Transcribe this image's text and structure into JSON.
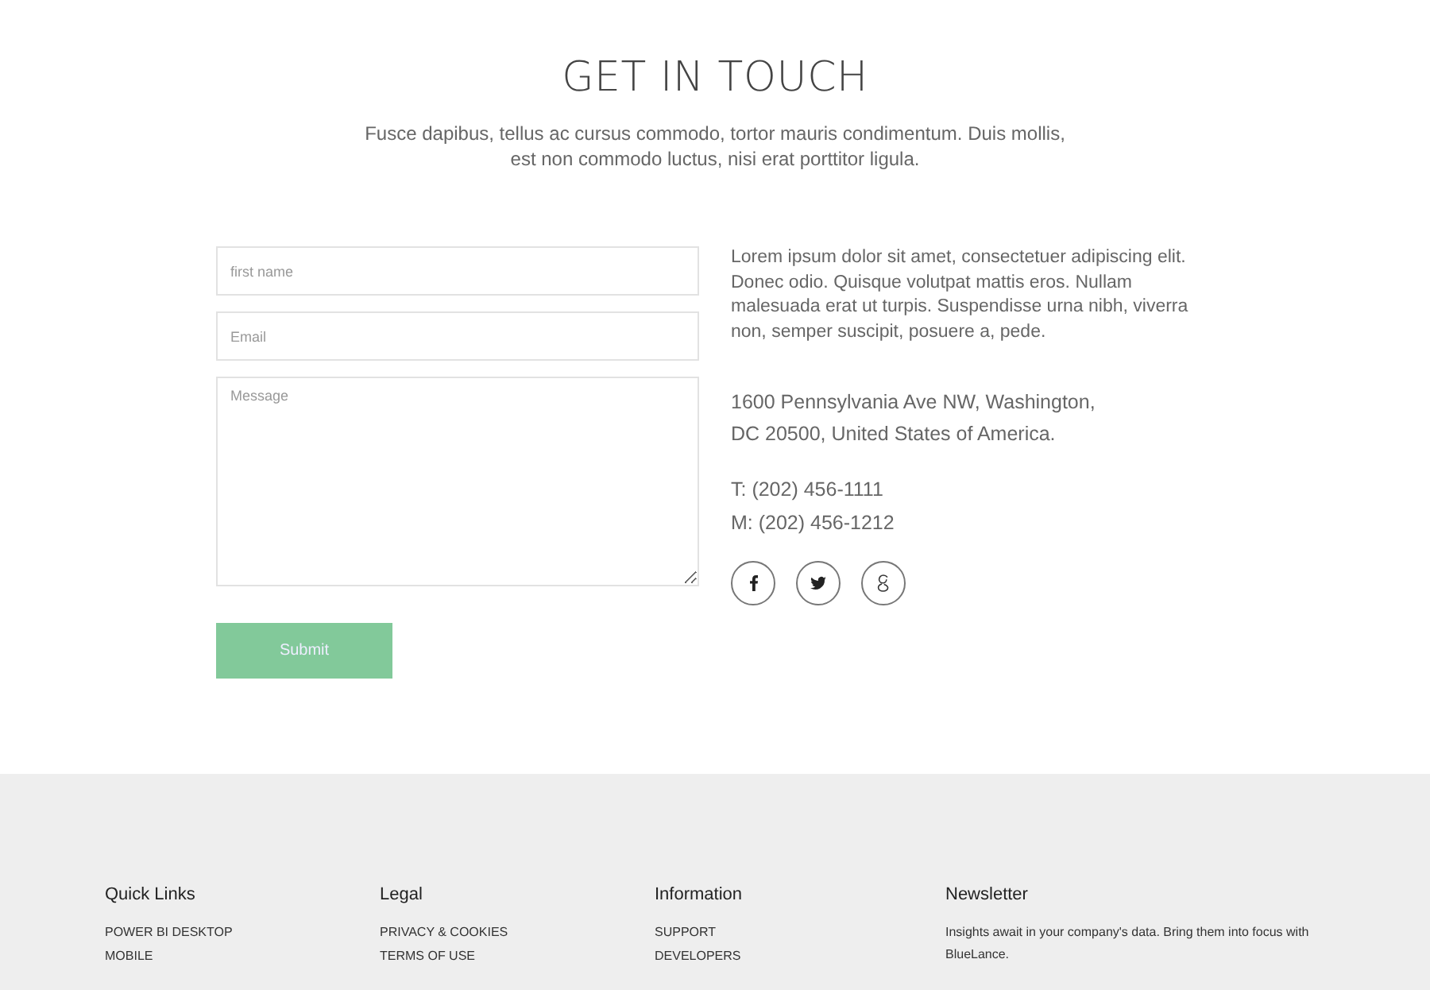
{
  "contact": {
    "title": "GET IN TOUCH",
    "subtitle": "Fusce dapibus, tellus ac cursus commodo, tortor mauris condimentum. Duis mollis,\nest non commodo luctus, nisi erat porttitor ligula.",
    "fields": [
      {
        "kind": "input",
        "placeholder": "first name"
      },
      {
        "kind": "input",
        "placeholder": "Email"
      },
      {
        "kind": "textarea",
        "placeholder": "Message"
      }
    ],
    "submit": "Submit",
    "intro": "Lorem ipsum dolor sit amet, consectetuer adipiscing elit. Donec odio. Quisque volutpat mattis eros. Nullam malesuada erat ut turpis. Suspendisse urna nibh, viverra non, semper suscipit, posuere a, pede.",
    "address": [
      "1600 Pennsylvania Ave NW, Washington,",
      "DC 20500, United States of America."
    ],
    "phones": [
      "T: (202) 456-1111",
      "M: (202) 456-1212"
    ],
    "social": [
      {
        "kind": "facebook"
      },
      {
        "kind": "twitter"
      },
      {
        "kind": "google"
      }
    ]
  },
  "footer": {
    "columns": [
      {
        "heading": "Quick Links",
        "links": [
          "POWER BI DESKTOP",
          "MOBILE"
        ]
      },
      {
        "heading": "Legal",
        "links": [
          "PRIVACY & COOKIES",
          "TERMS OF USE"
        ]
      },
      {
        "heading": "Information",
        "links": [
          "SUPPORT",
          "DEVELOPERS"
        ]
      },
      {
        "heading": "Newsletter",
        "text": "Insights await in your company's data. Bring them into focus with BlueLance."
      }
    ]
  }
}
